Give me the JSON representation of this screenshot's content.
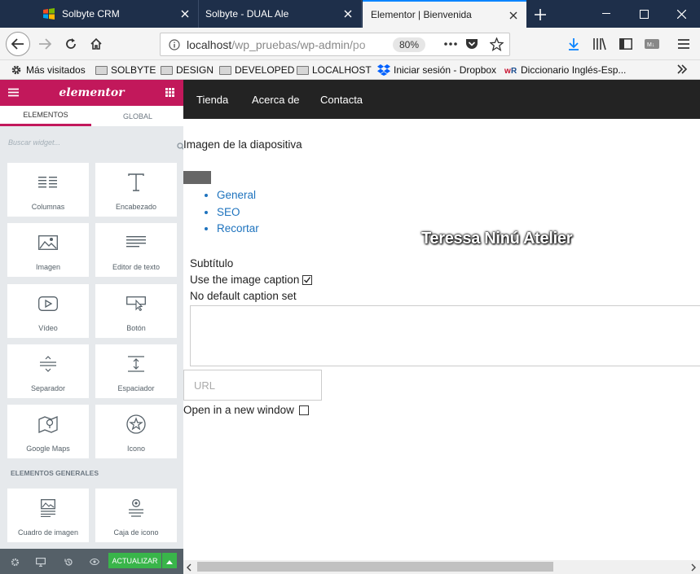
{
  "browser": {
    "tabs": [
      {
        "title": "Solbyte CRM",
        "active": false
      },
      {
        "title": "Solbyte - DUAL Ale",
        "active": false
      },
      {
        "title": "Elementor | Bienvenida",
        "active": true
      }
    ],
    "url": {
      "host": "localhost",
      "path": "/wp_pruebas/wp-admin/",
      "path_faded": "po"
    },
    "zoom": "80%",
    "bookmarks": [
      {
        "label": "Más visitados",
        "icon": "gear-icon"
      },
      {
        "label": "SOLBYTE",
        "icon": "folder-icon"
      },
      {
        "label": "DESIGN",
        "icon": "folder-icon"
      },
      {
        "label": "DEVELOPED",
        "icon": "folder-icon"
      },
      {
        "label": "LOCALHOST",
        "icon": "folder-icon"
      },
      {
        "label": "Iniciar sesión - Dropbox",
        "icon": "dropbox-icon"
      },
      {
        "label": "Diccionario Inglés-Esp...",
        "icon": "wordreference-icon"
      }
    ]
  },
  "elementor": {
    "logo": "elementor",
    "tabs": [
      "ELEMENTOS",
      "GLOBAL"
    ],
    "search_placeholder": "Buscar widget...",
    "widgets": [
      {
        "label": "Columnas",
        "icon": "columns-icon"
      },
      {
        "label": "Encabezado",
        "icon": "heading-icon"
      },
      {
        "label": "Imagen",
        "icon": "image-icon"
      },
      {
        "label": "Editor de texto",
        "icon": "text-editor-icon"
      },
      {
        "label": "Vídeo",
        "icon": "video-icon"
      },
      {
        "label": "Botón",
        "icon": "button-icon"
      },
      {
        "label": "Separador",
        "icon": "divider-icon"
      },
      {
        "label": "Espaciador",
        "icon": "spacer-icon"
      },
      {
        "label": "Google Maps",
        "icon": "map-icon"
      },
      {
        "label": "Icono",
        "icon": "star-icon"
      }
    ],
    "category": "ELEMENTOS GENERALES",
    "widgets_general": [
      {
        "label": "Cuadro de imagen",
        "icon": "image-box-icon"
      },
      {
        "label": "Caja de icono",
        "icon": "icon-box-icon"
      }
    ],
    "update_label": "ACTUALIZAR",
    "accent": "#c2185b",
    "update_color": "#39b54a"
  },
  "site": {
    "nav": [
      "Tienda",
      "Acerca de",
      "Contacta"
    ],
    "slide_label": "Imagen de la diapositiva",
    "tabs": [
      "General",
      "SEO",
      "Recortar"
    ],
    "overlay_title": "Teressa Ninú Atelier",
    "subtitle_label": "Subtítulo",
    "caption_checkbox_label": "Use the image caption",
    "caption_checked": true,
    "no_caption": "No default caption set",
    "url_placeholder": "URL",
    "new_window_label": "Open in a new window",
    "new_window_checked": false,
    "link_color": "#1e73be"
  }
}
